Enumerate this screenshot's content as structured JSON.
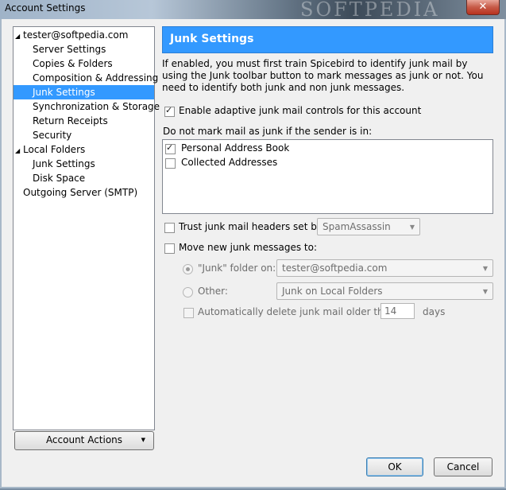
{
  "window": {
    "title": "Account Settings",
    "watermark": "SOFTPEDIA",
    "close_glyph": "✕"
  },
  "tree": {
    "items": [
      {
        "label": "tester@softpedia.com",
        "expanded": true
      },
      {
        "label": "Server Settings"
      },
      {
        "label": "Copies & Folders"
      },
      {
        "label": "Composition & Addressing"
      },
      {
        "label": "Junk Settings",
        "selected": true
      },
      {
        "label": "Synchronization & Storage"
      },
      {
        "label": "Return Receipts"
      },
      {
        "label": "Security"
      },
      {
        "label": "Local Folders",
        "expanded": true
      },
      {
        "label": "Junk Settings"
      },
      {
        "label": "Disk Space"
      },
      {
        "label": "Outgoing Server (SMTP)"
      }
    ],
    "account_actions_label": "Account Actions"
  },
  "panel": {
    "header": "Junk Settings",
    "description": "If enabled, you must first train Spicebird to identify junk mail by using the Junk toolbar button to mark messages as junk or not. You need to identify both junk and non junk messages.",
    "enable_adaptive": {
      "label": "Enable adaptive junk mail controls for this account",
      "checked": true
    },
    "whitelist_label": "Do not mark mail as junk if the sender is in:",
    "address_books": [
      {
        "label": "Personal Address Book",
        "checked": true
      },
      {
        "label": "Collected Addresses",
        "checked": false
      }
    ],
    "trust_headers": {
      "label": "Trust junk mail headers set by:",
      "checked": false,
      "value": "SpamAssassin"
    },
    "move_junk": {
      "label": "Move new junk messages to:",
      "checked": false
    },
    "junk_folder_on": {
      "label": "\"Junk\" folder on:",
      "value": "tester@softpedia.com",
      "selected": true
    },
    "other": {
      "label": "Other:",
      "value": "Junk on Local Folders",
      "selected": false
    },
    "auto_delete": {
      "label": "Automatically delete junk mail older than",
      "days_value": "14",
      "days_unit": "days",
      "checked": false
    }
  },
  "buttons": {
    "ok": "OK",
    "cancel": "Cancel"
  },
  "colors": {
    "selection": "#3399ff",
    "header_bg": "#3399ff"
  }
}
